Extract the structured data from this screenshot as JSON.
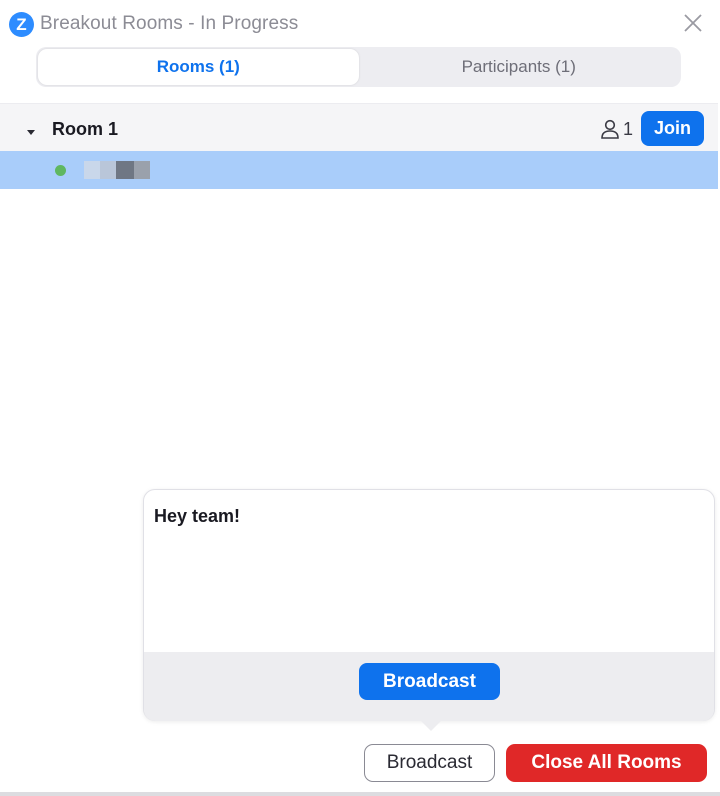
{
  "window": {
    "title": "Breakout Rooms - In Progress",
    "logo_letter": "Z"
  },
  "tabs": [
    {
      "label": "Rooms (1)",
      "active": true
    },
    {
      "label": "Participants (1)",
      "active": false
    }
  ],
  "rooms": [
    {
      "name": "Room 1",
      "participant_count": "1",
      "join_label": "Join",
      "expanded": true,
      "participants": [
        {
          "status": "online",
          "name_redacted": true
        }
      ]
    }
  ],
  "broadcast_popup": {
    "message": "Hey team!",
    "send_label": "Broadcast"
  },
  "actions": {
    "broadcast_label": "Broadcast",
    "close_all_label": "Close All Rooms"
  },
  "colors": {
    "accent": "#0e72ed",
    "danger": "#e02828",
    "selected_row": "#a9cdfa",
    "online": "#5fb760"
  }
}
